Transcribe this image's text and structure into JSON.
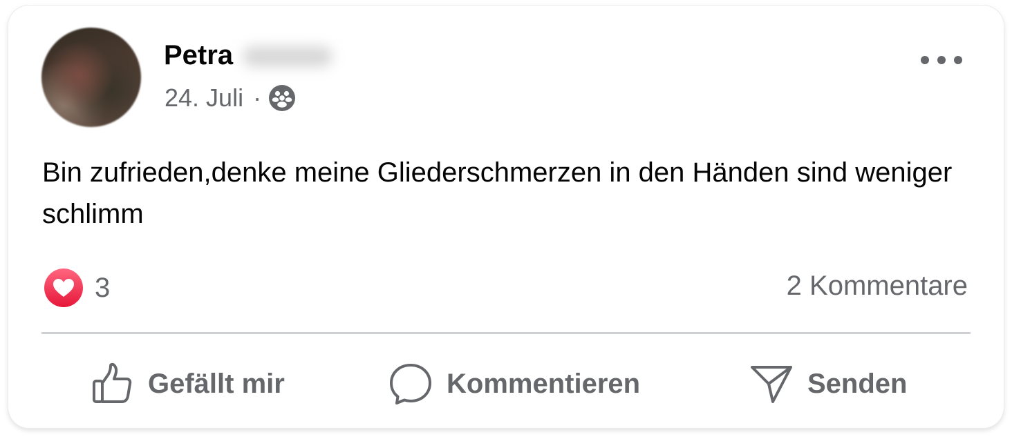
{
  "post": {
    "author_first_name": "Petra",
    "author_surname_redacted": true,
    "date": "24. Juli",
    "separator": "·",
    "audience_icon": "friends-audience-icon",
    "text": "Bin zufrieden,denke meine Gliederschmerzen in den Händen sind weniger schlimm",
    "menu_icon": "more-horizontal-icon"
  },
  "stats": {
    "reaction_icon": "love-reaction-icon",
    "reaction_count": "3",
    "comments_label": "2 Kommentare"
  },
  "actions": {
    "like": {
      "label": "Gefällt mir",
      "icon": "thumbs-up-icon"
    },
    "comment": {
      "label": "Kommentieren",
      "icon": "comment-bubble-icon"
    },
    "send": {
      "label": "Senden",
      "icon": "send-icon"
    }
  },
  "colors": {
    "text_primary": "#050505",
    "text_secondary": "#65676b",
    "divider": "#ced0d4",
    "love_reaction": "#f33e58"
  }
}
